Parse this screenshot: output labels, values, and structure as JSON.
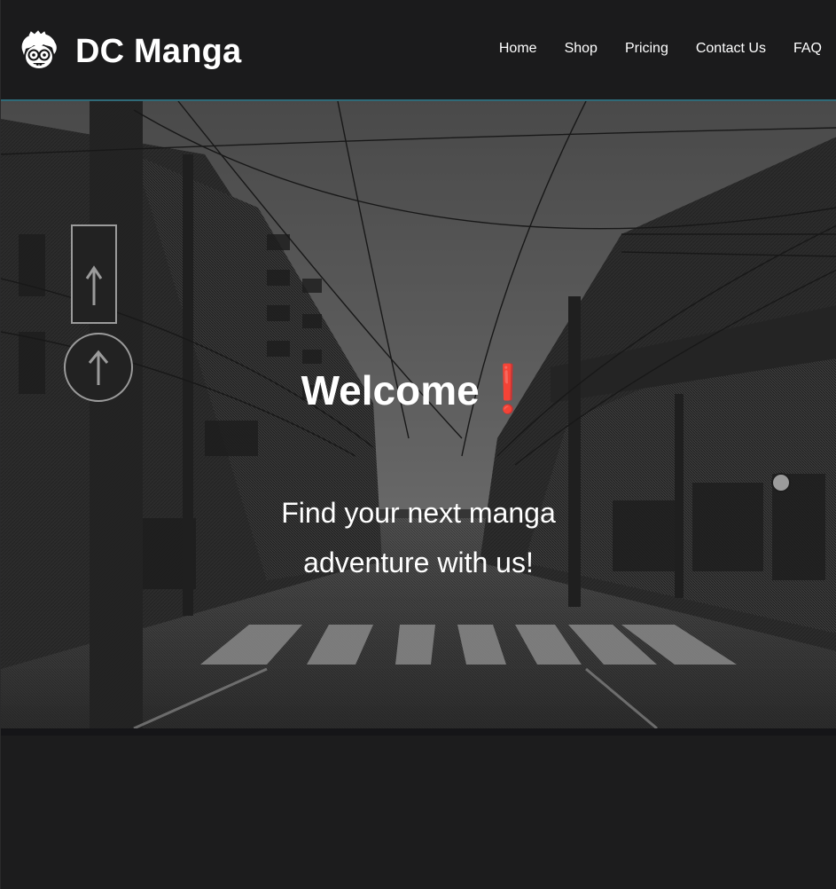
{
  "brand": {
    "name": "DC Manga",
    "logo_icon": "chibi-face-icon"
  },
  "nav": {
    "items": [
      {
        "label": "Home"
      },
      {
        "label": "Shop"
      },
      {
        "label": "Pricing"
      },
      {
        "label": "Contact Us"
      },
      {
        "label": "FAQ"
      }
    ]
  },
  "hero": {
    "title": "Welcome",
    "title_mark": "❗",
    "subtitle": "Find your next manga adventure with us!",
    "background": "manga-street-illustration"
  },
  "colors": {
    "background": "#1c1c1d",
    "header_border": "#2f6a78",
    "accent_red": "#c0303c",
    "text": "#ffffff"
  }
}
